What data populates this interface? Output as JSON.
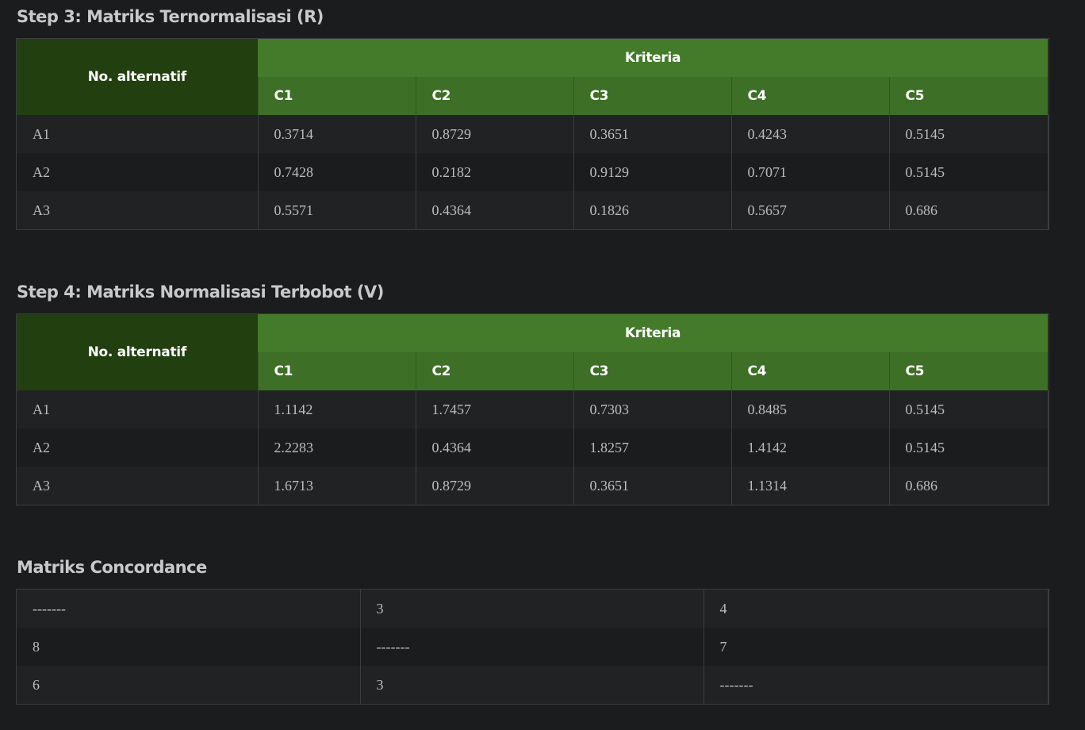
{
  "step3": {
    "title": "Step 3: Matriks Ternormalisasi (R)",
    "alt_header": "No. alternatif",
    "kriteria_header": "Kriteria",
    "columns": [
      "C1",
      "C2",
      "C3",
      "C4",
      "C5"
    ],
    "rows": [
      {
        "alt": "A1",
        "values": [
          "0.3714",
          "0.8729",
          "0.3651",
          "0.4243",
          "0.5145"
        ]
      },
      {
        "alt": "A2",
        "values": [
          "0.7428",
          "0.2182",
          "0.9129",
          "0.7071",
          "0.5145"
        ]
      },
      {
        "alt": "A3",
        "values": [
          "0.5571",
          "0.4364",
          "0.1826",
          "0.5657",
          "0.686"
        ]
      }
    ]
  },
  "step4": {
    "title": "Step 4: Matriks Normalisasi Terbobot (V)",
    "alt_header": "No. alternatif",
    "kriteria_header": "Kriteria",
    "columns": [
      "C1",
      "C2",
      "C3",
      "C4",
      "C5"
    ],
    "rows": [
      {
        "alt": "A1",
        "values": [
          "1.1142",
          "1.7457",
          "0.7303",
          "0.8485",
          "0.5145"
        ]
      },
      {
        "alt": "A2",
        "values": [
          "2.2283",
          "0.4364",
          "1.8257",
          "1.4142",
          "0.5145"
        ]
      },
      {
        "alt": "A3",
        "values": [
          "1.6713",
          "0.8729",
          "0.3651",
          "1.1314",
          "0.686"
        ]
      }
    ]
  },
  "concordance": {
    "title": "Matriks Concordance",
    "rows": [
      [
        "-------",
        "3",
        "4"
      ],
      [
        "8",
        "-------",
        "7"
      ],
      [
        "6",
        "3",
        "-------"
      ]
    ]
  },
  "colors": {
    "background": "#1b1c1e",
    "alt_header_bg": "#213f0f",
    "kriteria_header_bg": "#447b2a",
    "column_header_bg": "#3d6f26"
  }
}
